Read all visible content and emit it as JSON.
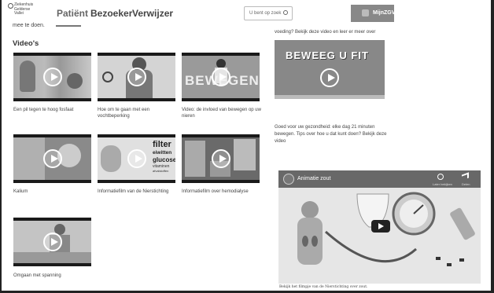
{
  "header": {
    "logo_text": [
      "Ziekenhuis",
      "Gelderse",
      "Vallei"
    ],
    "nav": [
      "Patiënt",
      "Bezoeker",
      "Verwijzer"
    ],
    "search_placeholder": "U bent op zoek",
    "login_label": "MijnZGV"
  },
  "intro_fragment": "mee te doen.",
  "videos_title": "Video's",
  "videos": [
    {
      "caption": "Een pil tegen te hoog fosfaat"
    },
    {
      "caption": "Hoe om te gaan met een vochtbeperking"
    },
    {
      "caption": "Video: de invloed van bewegen op uw nieren"
    },
    {
      "caption": "Kalium"
    },
    {
      "caption": "Informatiefilm van de Nierstichting"
    },
    {
      "caption": "Informatiefilm over hemodialyse"
    },
    {
      "caption": "Omgaan met spanning"
    }
  ],
  "thumb_texts": {
    "beweeg_strip": "BEWEGEN",
    "filter_words": [
      "filter",
      "eiwitten",
      "glucose",
      "vitaminen",
      "afvalstoffen"
    ]
  },
  "right": {
    "top_text": "voeding? Bekijk deze video en leer er meer over",
    "beweeg_title": "BEWEEG U FIT",
    "beweeg_text": "Goed voor uw gezondheid: elke dag 21 minuten bewegen. Tips over hoe u dat kunt doen? Bekijk deze video",
    "yt_title": "Animatie zout",
    "yt_watch_later": "Later bekijken",
    "yt_share": "Delen",
    "yt_caption": "Bekijk het filmpje van de Nierstichting over zout."
  }
}
